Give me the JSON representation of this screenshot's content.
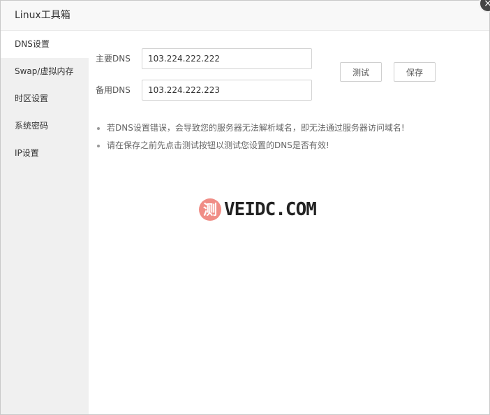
{
  "window": {
    "title": "Linux工具箱",
    "close_icon": "×"
  },
  "sidebar": {
    "items": [
      {
        "label": "DNS设置",
        "active": true
      },
      {
        "label": "Swap/虚拟内存",
        "active": false
      },
      {
        "label": "时区设置",
        "active": false
      },
      {
        "label": "系统密码",
        "active": false
      },
      {
        "label": "IP设置",
        "active": false
      }
    ]
  },
  "dns": {
    "primary_label": "主要DNS",
    "primary_value": "103.224.222.222",
    "secondary_label": "备用DNS",
    "secondary_value": "103.224.222.223",
    "test_label": "测试",
    "save_label": "保存"
  },
  "tips": [
    "若DNS设置错误，会导致您的服务器无法解析域名，即无法通过服务器访问域名!",
    "请在保存之前先点击测试按钮以测试您设置的DNS是否有效!"
  ],
  "watermark": {
    "badge": "测",
    "text": "VEIDC.COM",
    "color": "#f08d86"
  }
}
